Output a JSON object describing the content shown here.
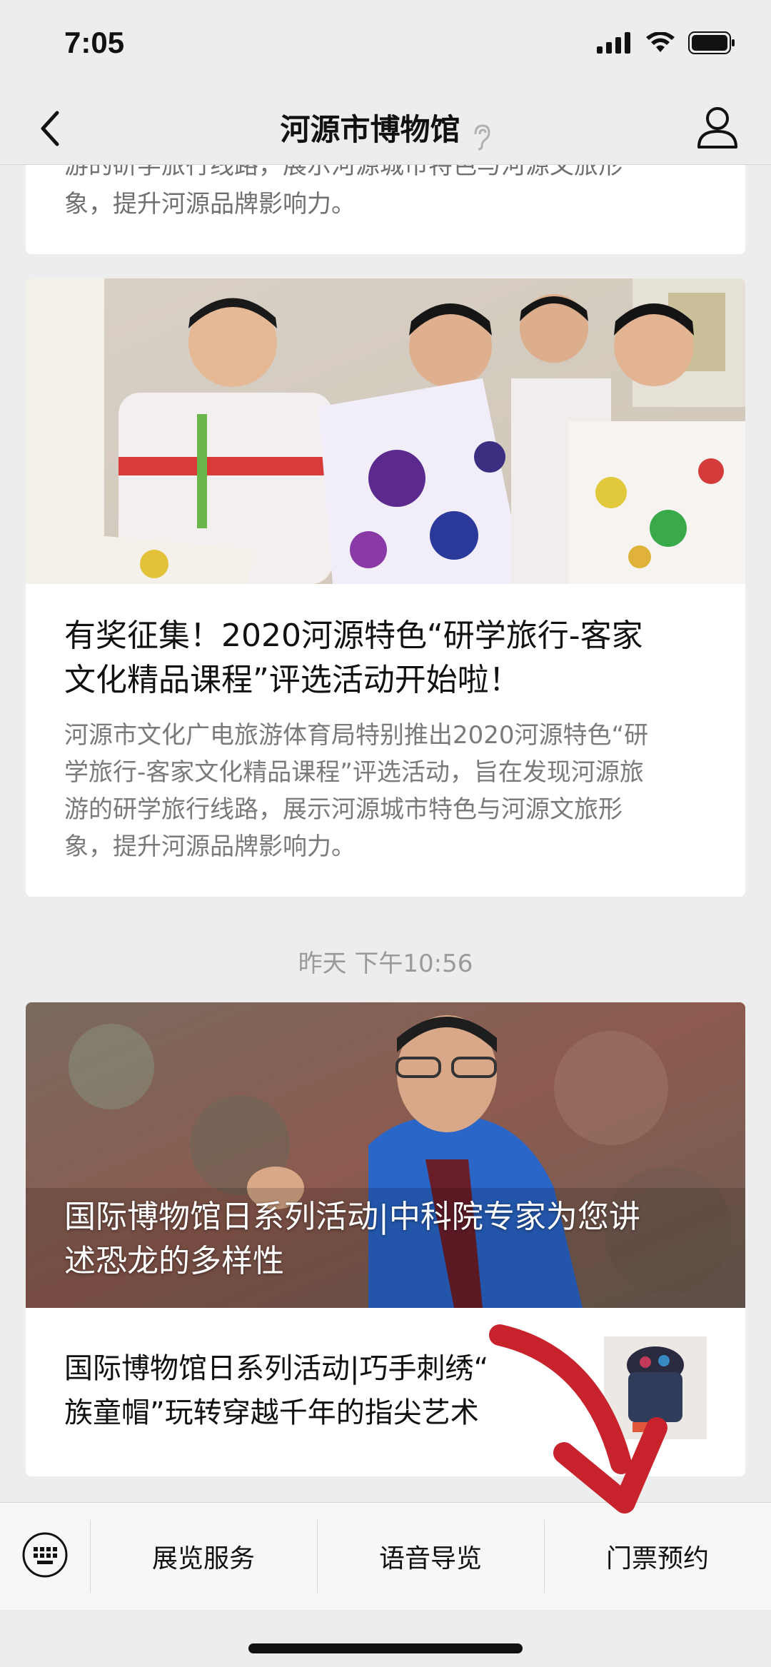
{
  "status_bar": {
    "time": "7:05"
  },
  "nav": {
    "title": "河源市博物馆"
  },
  "top_snippet": {
    "line1": "游的研学旅行线路，展示河源城市特色与河源文旅形",
    "line2": "象，提升河源品牌影响力。"
  },
  "article1": {
    "title_line1": "有奖征集！2020河源特色“研学旅行-客家",
    "title_line2": "文化精品课程”评选活动开始啦！",
    "summary_line1": "河源市文化广电旅游体育局特别推出2020河源特色“研",
    "summary_line2": "学旅行-客家文化精品课程”评选活动，旨在发现河源旅",
    "summary_line3": "游的研学旅行线路，展示河源城市特色与河源文旅形",
    "summary_line4": "象，提升河源品牌影响力。"
  },
  "timestamp": "昨天 下午10:56",
  "article2": {
    "overlay_line1": "国际博物馆日系列活动|中科院专家为您讲",
    "overlay_line2": "述恐龙的多样性",
    "sub_line1": "国际博物馆日系列活动|巧手刺绣“",
    "sub_line2": "族童帽”玩转穿越千年的指尖艺术"
  },
  "bottom_menu": {
    "items": [
      "展览服务",
      "语音导览",
      "门票预约"
    ]
  },
  "colors": {
    "background": "#ededed",
    "card": "#ffffff",
    "annotation_arrow": "#c8232d"
  },
  "icons": [
    "back-arrow-icon",
    "ear-icon",
    "profile-icon",
    "keyboard-icon",
    "signal-icon",
    "wifi-icon",
    "battery-icon"
  ]
}
